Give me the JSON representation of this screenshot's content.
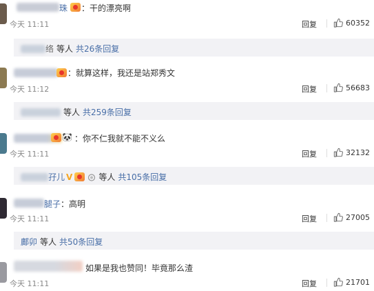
{
  "comments": [
    {
      "name_suffix": "珠",
      "text": "：干的漂亮啊",
      "time": "今天 11:11",
      "reply_label": "回复",
      "likes": "60352",
      "thread": {
        "name": "络",
        "etc": "等人",
        "count_label": "共26条回复"
      }
    },
    {
      "text": "：就算这样，我还是站郑秀文",
      "time": "今天 11:12",
      "reply_label": "回复",
      "likes": "56683",
      "thread": {
        "etc": "等人",
        "count_label": "共259条回复"
      }
    },
    {
      "text": "：你不仁我就不能不义么",
      "time": "今天 11:11",
      "reply_label": "回复",
      "likes": "32132",
      "thread": {
        "name": "孖儿",
        "etc": "等人",
        "count_label": "共105条回复"
      }
    },
    {
      "name_suffix": "腿子",
      "text": "：高明",
      "time": "今天 11:11",
      "reply_label": "回复",
      "likes": "27005",
      "thread": {
        "name": "鄺卯",
        "etc": "等人",
        "count_label": "共50条回复"
      }
    },
    {
      "text": "如果是我也赞同！毕竟那么渣",
      "time": "今天 11:11",
      "reply_label": "回复",
      "likes": "21701"
    }
  ],
  "colors": {
    "link": "#486ea7",
    "reply_box_bg": "#f2f2f5",
    "meta_text": "#888888"
  },
  "icons": {
    "like": "thumbs-up-icon",
    "badge": "vip-badge-icon"
  }
}
